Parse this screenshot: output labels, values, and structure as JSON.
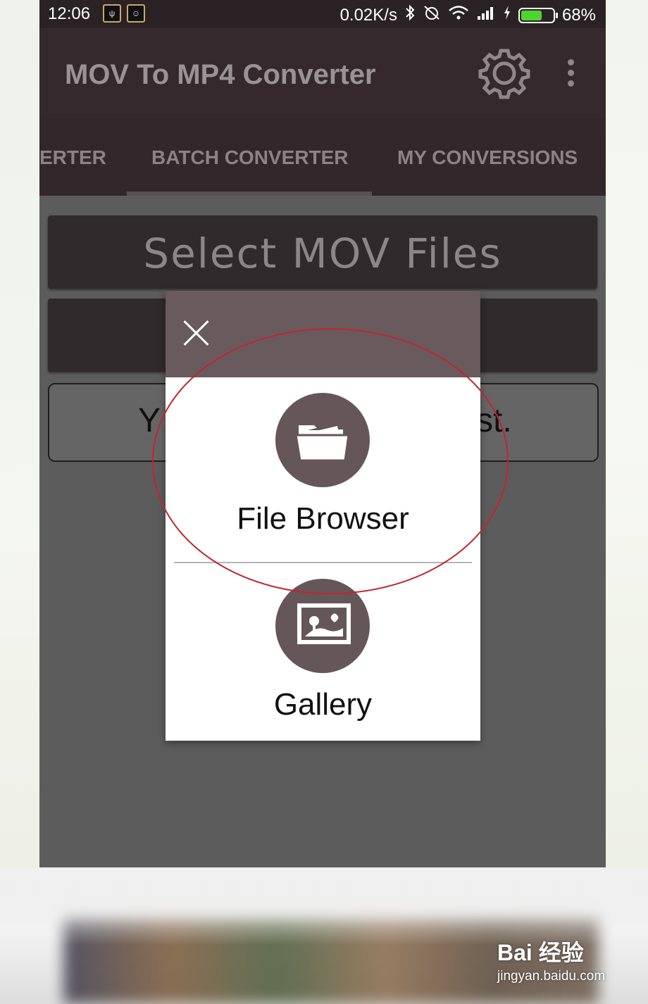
{
  "status_bar": {
    "time": "12:06",
    "network_speed": "0.02K/s",
    "battery_percent": "68%",
    "battery_level": 0.68,
    "battery_color": "#4dd52e",
    "icons": [
      "bluetooth-icon",
      "alarm-off-icon",
      "wifi-icon",
      "signal-icon",
      "charging-icon"
    ]
  },
  "app_bar": {
    "title": "MOV To MP4 Converter",
    "settings_icon": "gear-icon",
    "menu_icon": "overflow-menu-icon"
  },
  "tabs": [
    {
      "label": "ERTER"
    },
    {
      "label": "BATCH CONVERTER",
      "selected": true
    },
    {
      "label": "MY CONVERSIONS"
    }
  ],
  "main": {
    "select_button_label": "Select MOV Files",
    "notice_left": "Y",
    "notice_right": "st."
  },
  "dialog": {
    "close_icon": "close-icon",
    "options": [
      {
        "label": "File Browser",
        "icon": "folder-icon"
      },
      {
        "label": "Gallery",
        "icon": "image-icon"
      }
    ]
  },
  "watermark": {
    "logo": "Bai 经验",
    "url": "jingyan.baidu.com"
  },
  "colors": {
    "appbar": "#35292d",
    "dialog_header": "#695a5e",
    "icon_circle": "#655659",
    "annotation": "#c0262c"
  }
}
